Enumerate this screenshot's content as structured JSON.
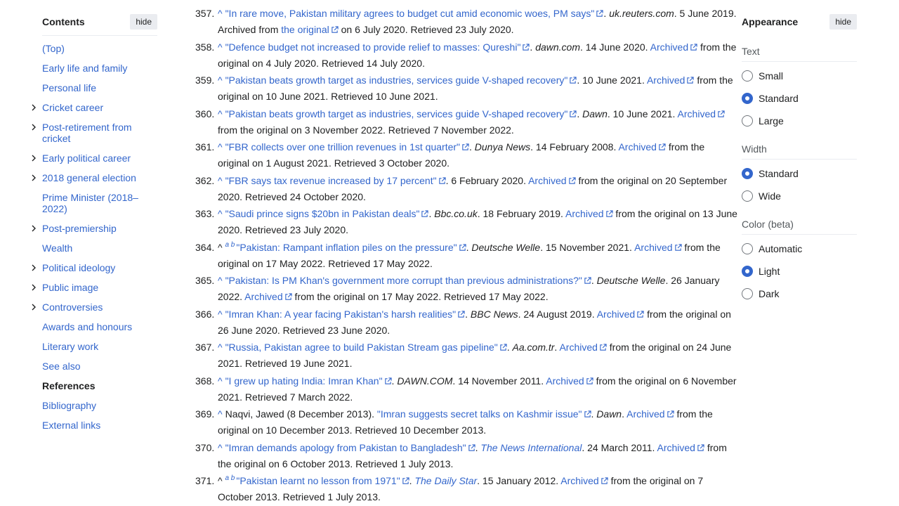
{
  "toc": {
    "title": "Contents",
    "hide_label": "hide",
    "items": [
      {
        "label": "(Top)",
        "expandable": false
      },
      {
        "label": "Early life and family",
        "expandable": false
      },
      {
        "label": "Personal life",
        "expandable": false
      },
      {
        "label": "Cricket career",
        "expandable": true
      },
      {
        "label": "Post-retirement from cricket",
        "expandable": true
      },
      {
        "label": "Early political career",
        "expandable": true
      },
      {
        "label": "2018 general election",
        "expandable": true
      },
      {
        "label": "Prime Minister (2018–2022)",
        "expandable": false
      },
      {
        "label": "Post-premiership",
        "expandable": true
      },
      {
        "label": "Wealth",
        "expandable": false
      },
      {
        "label": "Political ideology",
        "expandable": true
      },
      {
        "label": "Public image",
        "expandable": true
      },
      {
        "label": "Controversies",
        "expandable": true
      },
      {
        "label": "Awards and honours",
        "expandable": false
      },
      {
        "label": "Literary work",
        "expandable": false
      },
      {
        "label": "See also",
        "expandable": false
      },
      {
        "label": "References",
        "expandable": false,
        "active": true
      },
      {
        "label": "Bibliography",
        "expandable": false
      },
      {
        "label": "External links",
        "expandable": false
      }
    ]
  },
  "appearance": {
    "title": "Appearance",
    "hide_label": "hide",
    "text_group": "Text",
    "text_options": [
      {
        "label": "Small",
        "selected": false
      },
      {
        "label": "Standard",
        "selected": true
      },
      {
        "label": "Large",
        "selected": false
      }
    ],
    "width_group": "Width",
    "width_options": [
      {
        "label": "Standard",
        "selected": true
      },
      {
        "label": "Wide",
        "selected": false
      }
    ],
    "color_group": "Color (beta)",
    "color_options": [
      {
        "label": "Automatic",
        "selected": false
      },
      {
        "label": "Light",
        "selected": true
      },
      {
        "label": "Dark",
        "selected": false
      }
    ]
  },
  "refs": {
    "r357": {
      "num": "357.",
      "title": "\"In rare move, Pakistan military agrees to budget cut amid economic woes, PM says\"",
      "pub": "uk.reuters.com",
      "after": ". 5 June 2019. Archived from ",
      "orig": "the original",
      "tail": " on 6 July 2020. Retrieved 23 July 2020."
    },
    "r358": {
      "num": "358.",
      "title": "\"Defence budget not increased to provide relief to masses: Qureshi\"",
      "pub": "dawn.com",
      "after": ". 14 June 2020. ",
      "arch": "Archived",
      "tail": " from the original on 4 July 2020. Retrieved 14 July 2020."
    },
    "r359": {
      "num": "359.",
      "title": "\"Pakistan beats growth target as industries, services guide V-shaped recovery\"",
      "after": ". 10 June 2021. ",
      "arch": "Archived",
      "tail": " from the original on 10 June 2021. Retrieved 10 June 2021."
    },
    "r360": {
      "num": "360.",
      "title": "\"Pakistan beats growth target as industries, services guide V-shaped recovery\"",
      "pub": "Dawn",
      "after": ". 10 June 2021. ",
      "arch": "Archived",
      "tail": " from the original on 3 November 2022. Retrieved 7 November 2022."
    },
    "r361": {
      "num": "361.",
      "title": "\"FBR collects over one trillion revenues in 1st quarter\"",
      "pub": "Dunya News",
      "after": ". 14 February 2008. ",
      "arch": "Archived",
      "tail": " from the original on 1 August 2021. Retrieved 3 October 2020."
    },
    "r362": {
      "num": "362.",
      "title": "\"FBR says tax revenue increased by 17 percent\"",
      "after": ". 6 February 2020. ",
      "arch": "Archived",
      "tail": " from the original on 20 September 2020. Retrieved 24 October 2020."
    },
    "r363": {
      "num": "363.",
      "title": "\"Saudi prince signs $20bn in Pakistan deals\"",
      "pub": "Bbc.co.uk",
      "after": ". 18 February 2019. ",
      "arch": "Archived",
      "tail": " from the original on 13 June 2020. Retrieved 23 July 2020."
    },
    "r364": {
      "num": "364.",
      "title": "\"Pakistan: Rampant inflation piles on the pressure\"",
      "pub": "Deutsche Welle",
      "after": ". 15 November 2021. ",
      "arch": "Archived",
      "tail": " from the original on 17 May 2022. Retrieved 17 May 2022.",
      "sup": "a b"
    },
    "r365": {
      "num": "365.",
      "title": "\"Pakistan: Is PM Khan's government more corrupt than previous administrations?\"",
      "pub": "Deutsche Welle",
      "after": ". 26 January 2022. ",
      "arch": "Archived",
      "tail": " from the original on 17 May 2022. Retrieved 17 May 2022."
    },
    "r366": {
      "num": "366.",
      "title": "\"Imran Khan: A year facing Pakistan's harsh realities\"",
      "pub": "BBC News",
      "after": ". 24 August 2019. ",
      "arch": "Archived",
      "tail": " from the original on 26 June 2020. Retrieved 23 June 2020."
    },
    "r367": {
      "num": "367.",
      "title": "\"Russia, Pakistan agree to build Pakistan Stream gas pipeline\"",
      "pub": "Aa.com.tr",
      "after": ". ",
      "arch": "Archived",
      "tail": " from the original on 24 June 2021. Retrieved 19 June 2021."
    },
    "r368": {
      "num": "368.",
      "title": "\"I grew up hating India: Imran Khan\"",
      "pub": "DAWN.COM",
      "after": ". 14 November 2011. ",
      "arch": "Archived",
      "tail": " from the original on 6 November 2021. Retrieved 7 March 2022."
    },
    "r369": {
      "num": "369.",
      "pre": "Naqvi, Jawed (8 December 2013). ",
      "title": "\"Imran suggests secret talks on Kashmir issue\"",
      "pub": "Dawn",
      "after": ". ",
      "arch": "Archived",
      "tail": " from the original on 10 December 2013. Retrieved 10 December 2013."
    },
    "r370": {
      "num": "370.",
      "title": "\"Imran demands apology from Pakistan to Bangladesh\"",
      "publink": "The News International",
      "after": ". 24 March 2011. ",
      "arch": "Archived",
      "tail": " from the original on 6 October 2013. Retrieved 1 July 2013."
    },
    "r371": {
      "num": "371.",
      "title": "\"Pakistan learnt no lesson from 1971\"",
      "publink": "The Daily Star",
      "after": ". 15 January 2012. ",
      "arch": "Archived",
      "tail": " from the original on 7 October 2013. Retrieved 1 July 2013.",
      "sup": "a b"
    }
  },
  "colors": {
    "link": "#3366cc",
    "text": "#202122",
    "radio_selected": "#3366cc"
  }
}
